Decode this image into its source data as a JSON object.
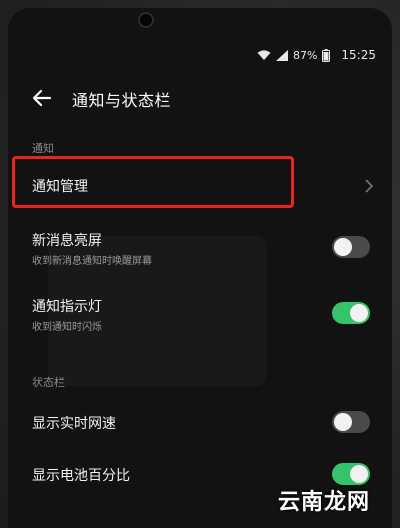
{
  "status_bar": {
    "battery": "87%",
    "time": "15:25"
  },
  "header": {
    "title": "通知与状态栏"
  },
  "sections": {
    "notification": "通知",
    "statusbar": "状态栏"
  },
  "rows": {
    "notification_management": {
      "label": "通知管理"
    },
    "new_message_wake": {
      "label": "新消息亮屏",
      "sub": "收到新消息通知时唤醒屏幕",
      "enabled": false
    },
    "notification_light": {
      "label": "通知指示灯",
      "sub": "收到通知时闪烁",
      "enabled": true
    },
    "realtime_speed": {
      "label": "显示实时网速",
      "enabled": false
    },
    "battery_percentage": {
      "label": "显示电池百分比",
      "enabled": true
    }
  },
  "watermark": "云南龙网",
  "colors": {
    "toggle_on": "#35c46a",
    "highlight": "#e8261d"
  }
}
